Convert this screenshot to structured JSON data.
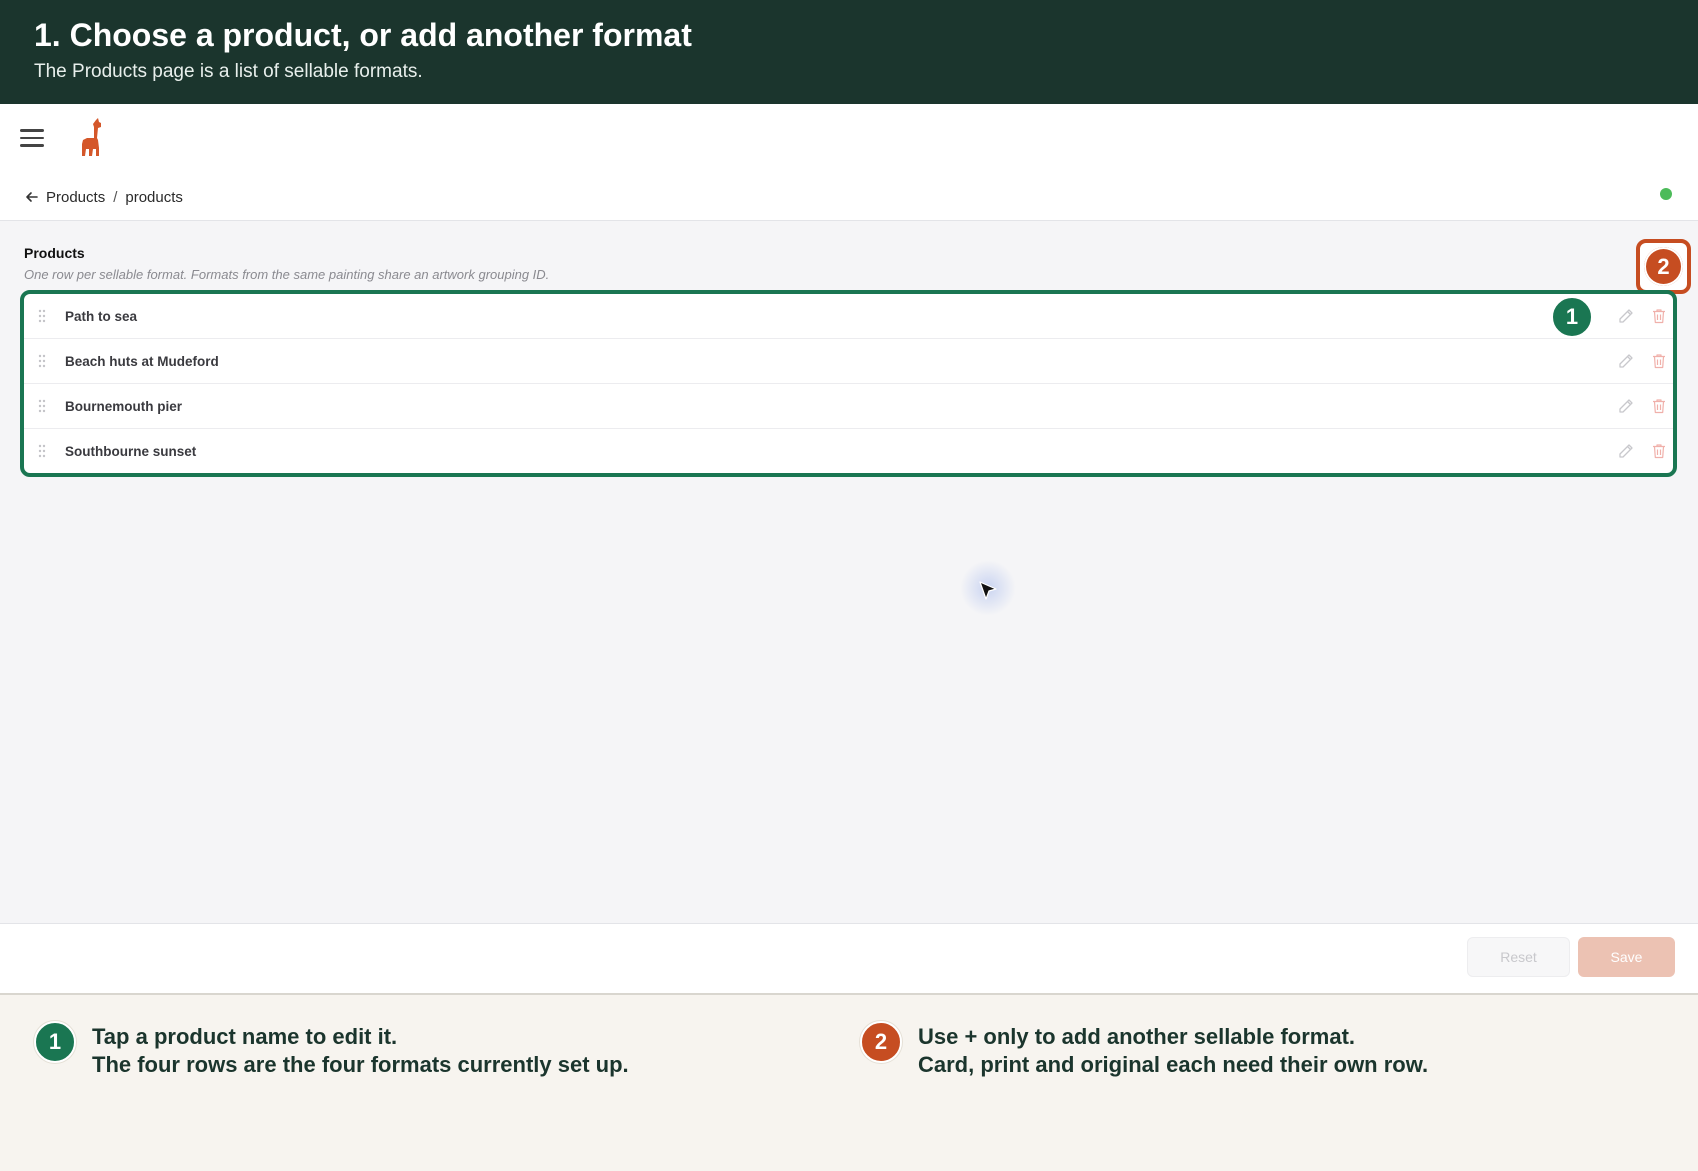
{
  "banner": {
    "title": "1. Choose a product, or add another format",
    "subtitle": "The Products page is a list of sellable formats."
  },
  "header": {
    "menu_icon": "hamburger-menu-icon",
    "logo_icon": "llama-logo",
    "logo_color": "#d4572a",
    "breadcrumb": {
      "back_icon": "arrow-left-icon",
      "parent": "Products",
      "separator": "/",
      "current": "products"
    },
    "status_color": "#4cbb5a"
  },
  "section": {
    "title": "Products",
    "description": "One row per sellable format. Formats from the same painting share an artwork grouping ID.",
    "add_badge": "2"
  },
  "products": {
    "rows": [
      {
        "name": "Path to sea",
        "badge": "1"
      },
      {
        "name": "Beach huts at Mudeford"
      },
      {
        "name": "Bournemouth pier"
      },
      {
        "name": "Southbourne sunset"
      }
    ]
  },
  "footer": {
    "reset_label": "Reset",
    "save_label": "Save"
  },
  "legend": {
    "item1": {
      "badge": "1",
      "line1": "Tap a product name to edit it.",
      "line2": "The four rows are the four formats currently set up."
    },
    "item2": {
      "badge": "2",
      "line1": "Use + only to add another sellable format.",
      "line2": "Card, print and original each need their own row."
    }
  },
  "colors": {
    "banner_bg": "#1b352d",
    "highlight_green": "#1a7652",
    "highlight_orange": "#c64d21",
    "save_disabled": "#ecc2b3"
  }
}
